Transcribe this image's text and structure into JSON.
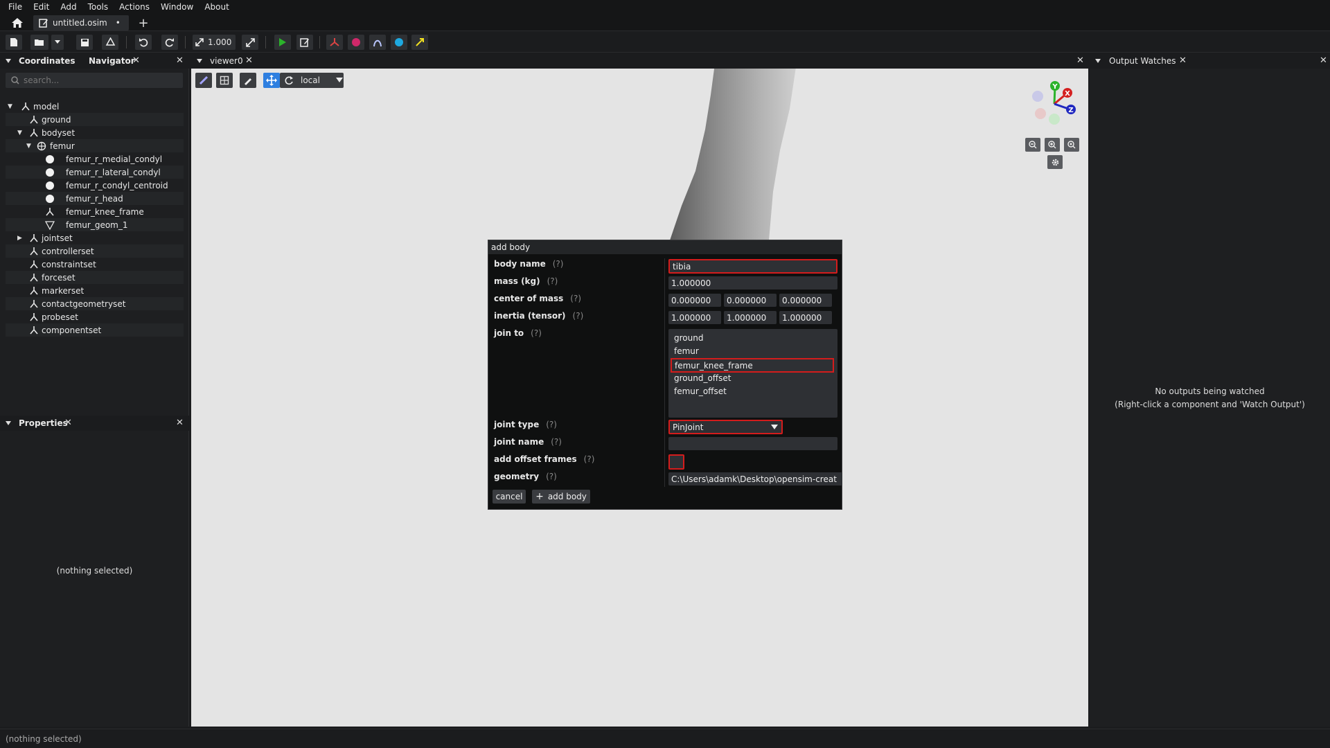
{
  "menu": [
    "File",
    "Edit",
    "Add",
    "Tools",
    "Actions",
    "Window",
    "About"
  ],
  "tabs": {
    "document": "untitled.osim",
    "modified_marker": "•",
    "add": "+"
  },
  "toolbar": {
    "scale_value": "1.000"
  },
  "left_panel": {
    "coordinates_tab": "Coordinates",
    "navigator_tab": "Navigator",
    "search_placeholder": "search...",
    "tree": [
      {
        "label": "model",
        "depth": 0,
        "expanded": true,
        "icon": "frame-icon"
      },
      {
        "label": "ground",
        "depth": 1,
        "icon": "frame-icon"
      },
      {
        "label": "bodyset",
        "depth": 1,
        "expanded": true,
        "icon": "frame-icon"
      },
      {
        "label": "femur",
        "depth": 2,
        "expanded": true,
        "icon": "body-icon"
      },
      {
        "label": "femur_r_medial_condyl",
        "depth": 3,
        "icon": "sphere-icon"
      },
      {
        "label": "femur_r_lateral_condyl",
        "depth": 3,
        "icon": "sphere-icon"
      },
      {
        "label": "femur_r_condyl_centroid",
        "depth": 3,
        "icon": "sphere-icon"
      },
      {
        "label": "femur_r_head",
        "depth": 3,
        "icon": "sphere-icon"
      },
      {
        "label": "femur_knee_frame",
        "depth": 3,
        "icon": "frame-icon"
      },
      {
        "label": "femur_geom_1",
        "depth": 3,
        "icon": "mesh-icon"
      },
      {
        "label": "jointset",
        "depth": 1,
        "collapsed": true,
        "icon": "frame-icon"
      },
      {
        "label": "controllerset",
        "depth": 1,
        "icon": "frame-icon"
      },
      {
        "label": "constraintset",
        "depth": 1,
        "icon": "frame-icon"
      },
      {
        "label": "forceset",
        "depth": 1,
        "icon": "frame-icon"
      },
      {
        "label": "markerset",
        "depth": 1,
        "icon": "frame-icon"
      },
      {
        "label": "contactgeometryset",
        "depth": 1,
        "icon": "frame-icon"
      },
      {
        "label": "probeset",
        "depth": 1,
        "icon": "frame-icon"
      },
      {
        "label": "componentset",
        "depth": 1,
        "icon": "frame-icon"
      }
    ],
    "properties_title": "Properties",
    "properties_empty": "(nothing selected)"
  },
  "viewer": {
    "title": "viewer0",
    "frame_mode": "local",
    "axes": {
      "x": "X",
      "y": "Y",
      "z": "Z"
    }
  },
  "right_panel": {
    "title": "Output Watches",
    "empty_line1": "No outputs being watched",
    "empty_line2": "(Right-click a component and 'Watch Output')"
  },
  "dialog": {
    "title": "add body",
    "help": "(?)",
    "labels": {
      "body_name": "body name",
      "mass": "mass (kg)",
      "center_of_mass": "center of mass",
      "inertia": "inertia (tensor)",
      "join_to": "join to",
      "joint_type": "joint type",
      "joint_name": "joint name",
      "add_offset_frames": "add offset frames",
      "geometry": "geometry"
    },
    "values": {
      "body_name": "tibia",
      "mass": "1.000000",
      "com": [
        "0.000000",
        "0.000000",
        "0.000000"
      ],
      "inertia": [
        "1.000000",
        "1.000000",
        "1.000000"
      ],
      "joint_type": "PinJoint",
      "joint_name": "",
      "geometry": "C:\\Users\\adamk\\Desktop\\opensim-creat"
    },
    "join_options": [
      "ground",
      "femur",
      "femur_knee_frame",
      "ground_offset",
      "femur_offset"
    ],
    "selected_join": "femur_knee_frame",
    "cancel": "cancel",
    "add_body": "add body"
  },
  "status": "(nothing selected)",
  "colors": {
    "highlight": "#d41c1c",
    "accent_blue": "#2e7fe0",
    "play_green": "#2bb32b"
  }
}
